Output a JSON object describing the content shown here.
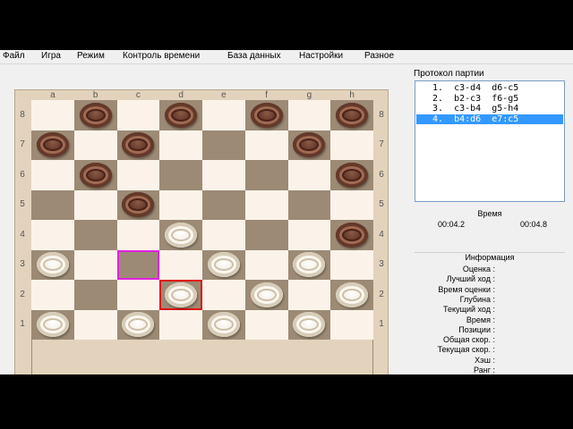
{
  "menu": [
    "Файл",
    "Игра",
    "Режим",
    "Контроль времени",
    "База данных",
    "Настройки",
    "Разное"
  ],
  "board": {
    "files": [
      "a",
      "b",
      "c",
      "d",
      "e",
      "f",
      "g",
      "h"
    ],
    "ranks": [
      "8",
      "7",
      "6",
      "5",
      "4",
      "3",
      "2",
      "1"
    ],
    "colors": {
      "light": "#fbf3ea",
      "dark": "#9c8a75"
    },
    "pieces": [
      {
        "square": "b8",
        "color": "black"
      },
      {
        "square": "d8",
        "color": "black"
      },
      {
        "square": "f8",
        "color": "black"
      },
      {
        "square": "h8",
        "color": "black"
      },
      {
        "square": "a7",
        "color": "black"
      },
      {
        "square": "c7",
        "color": "black"
      },
      {
        "square": "g7",
        "color": "black"
      },
      {
        "square": "b6",
        "color": "black"
      },
      {
        "square": "h6",
        "color": "black"
      },
      {
        "square": "c5",
        "color": "black"
      },
      {
        "square": "h4",
        "color": "black"
      },
      {
        "square": "d4",
        "color": "white"
      },
      {
        "square": "a3",
        "color": "white"
      },
      {
        "square": "e3",
        "color": "white"
      },
      {
        "square": "g3",
        "color": "white"
      },
      {
        "square": "d2",
        "color": "white"
      },
      {
        "square": "f2",
        "color": "white"
      },
      {
        "square": "h2",
        "color": "white"
      },
      {
        "square": "a1",
        "color": "white"
      },
      {
        "square": "c1",
        "color": "white"
      },
      {
        "square": "e1",
        "color": "white"
      },
      {
        "square": "g1",
        "color": "white"
      }
    ],
    "highlights": [
      {
        "square": "c3",
        "color": "#e020e0"
      },
      {
        "square": "d2",
        "color": "#e01010"
      }
    ]
  },
  "protocol": {
    "label": "Протокол партии",
    "moves": [
      "1.  c3-d4  d6-c5",
      "2.  b2-c3  f6-g5",
      "3.  c3-b4  g5-h4",
      "4.  b4:d6  e7:c5"
    ],
    "selected_index": 3
  },
  "time": {
    "label": "Время",
    "white": "00:04.2",
    "black": "00:04.8"
  },
  "info": {
    "label": "Информация",
    "rows": [
      "Оценка :",
      "Лучший ход :",
      "Время оценки :",
      "Глубина :",
      "Текущий ход :",
      "Время :",
      "Позиции :",
      "Общая скор. :",
      "Текущая скор. :",
      "Хэш :",
      "Ранг :"
    ]
  }
}
